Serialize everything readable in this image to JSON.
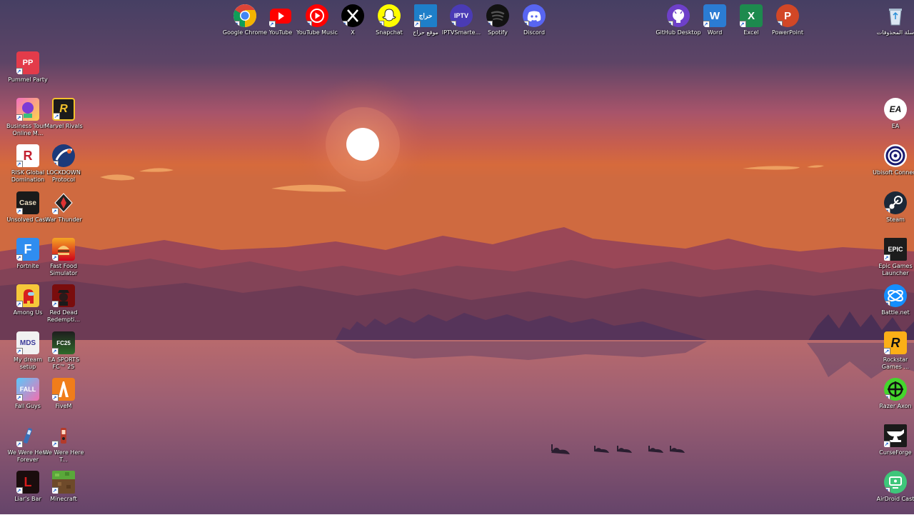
{
  "desktop": {
    "top_icons": [
      {
        "label": "Google Chrome",
        "icon": "chrome-icon"
      },
      {
        "label": "YouTube",
        "icon": "youtube-icon"
      },
      {
        "label": "YouTube Music",
        "icon": "youtube-music-icon"
      },
      {
        "label": "X",
        "icon": "x-icon"
      },
      {
        "label": "Snapchat",
        "icon": "snapchat-icon"
      },
      {
        "label": "موقع حراج",
        "icon": "haraj-icon",
        "glyph": "حراج"
      },
      {
        "label": "IPTVSmarte...",
        "icon": "iptv-icon",
        "glyph": "IPTV"
      },
      {
        "label": "Spotify",
        "icon": "spotify-icon"
      },
      {
        "label": "Discord",
        "icon": "discord-icon"
      },
      {
        "label": "GitHub Desktop",
        "icon": "github-icon"
      },
      {
        "label": "Word",
        "icon": "word-icon",
        "glyph": "W"
      },
      {
        "label": "Excel",
        "icon": "excel-icon",
        "glyph": "X"
      },
      {
        "label": "PowerPoint",
        "icon": "powerpoint-icon",
        "glyph": "P"
      },
      {
        "label": "سلة المحذوفات",
        "icon": "recycle-bin-icon"
      }
    ],
    "left_col1": [
      {
        "label": "Pummel Party",
        "icon": "pummel-party-icon",
        "glyph": "PP"
      },
      {
        "label": "Business Tour - Online M...",
        "icon": "business-tour-icon"
      },
      {
        "label": "RISK Global Domination",
        "icon": "risk-icon",
        "glyph": "R"
      },
      {
        "label": "Unsolved Case",
        "icon": "unsolved-case-icon",
        "glyph": "Case"
      },
      {
        "label": "Fortnite",
        "icon": "fortnite-icon",
        "glyph": "F"
      },
      {
        "label": "Among Us",
        "icon": "among-us-icon"
      },
      {
        "label": "My dream setup",
        "icon": "my-dream-setup-icon",
        "glyph": "MDS"
      },
      {
        "label": "Fall Guys",
        "icon": "fall-guys-icon",
        "glyph": "FALL"
      },
      {
        "label": "We Were Here Forever",
        "icon": "we-were-here-forever-icon"
      },
      {
        "label": "Liar's Bar",
        "icon": "liars-bar-icon",
        "glyph": "L"
      }
    ],
    "left_col2": [
      {
        "label": "Marvel Rivals",
        "icon": "marvel-rivals-icon",
        "glyph": "R"
      },
      {
        "label": "LOCKDOWN Protocol",
        "icon": "lockdown-protocol-icon"
      },
      {
        "label": "War Thunder",
        "icon": "war-thunder-icon"
      },
      {
        "label": "Fast Food Simulator",
        "icon": "fast-food-simulator-icon"
      },
      {
        "label": "Red Dead Redempti...",
        "icon": "red-dead-redemption-icon"
      },
      {
        "label": "EA SPORTS FC™ 25",
        "icon": "ea-sports-fc-icon",
        "glyph": "FC25"
      },
      {
        "label": "FiveM",
        "icon": "fivem-icon"
      },
      {
        "label": "We Were Here T...",
        "icon": "we-were-here-together-icon"
      },
      {
        "label": "Minecraft",
        "icon": "minecraft-icon"
      }
    ],
    "right_col": [
      {
        "label": "EA",
        "icon": "ea-icon",
        "glyph": "EA"
      },
      {
        "label": "Ubisoft Connect",
        "icon": "ubisoft-connect-icon"
      },
      {
        "label": "Steam",
        "icon": "steam-icon"
      },
      {
        "label": "Epic Games Launcher",
        "icon": "epic-games-icon",
        "glyph": "EPIC"
      },
      {
        "label": "Battle.net",
        "icon": "battlenet-icon"
      },
      {
        "label": "Rockstar Games ...",
        "icon": "rockstar-games-icon",
        "glyph": "R"
      },
      {
        "label": "Razer Axon",
        "icon": "razer-axon-icon"
      },
      {
        "label": "CurseForge",
        "icon": "curseforge-icon"
      },
      {
        "label": "AirDroid Cast",
        "icon": "airdroid-cast-icon"
      }
    ]
  },
  "wallpaper": {
    "colors": {
      "sky_top": "#463f63",
      "sky_mid": "#a8546a",
      "sky_low": "#d2683e",
      "sun": "#ffffff",
      "mountains_far": "#9a4757",
      "mountains_near": "#6d3b55",
      "water": "#8d5a6e"
    }
  }
}
